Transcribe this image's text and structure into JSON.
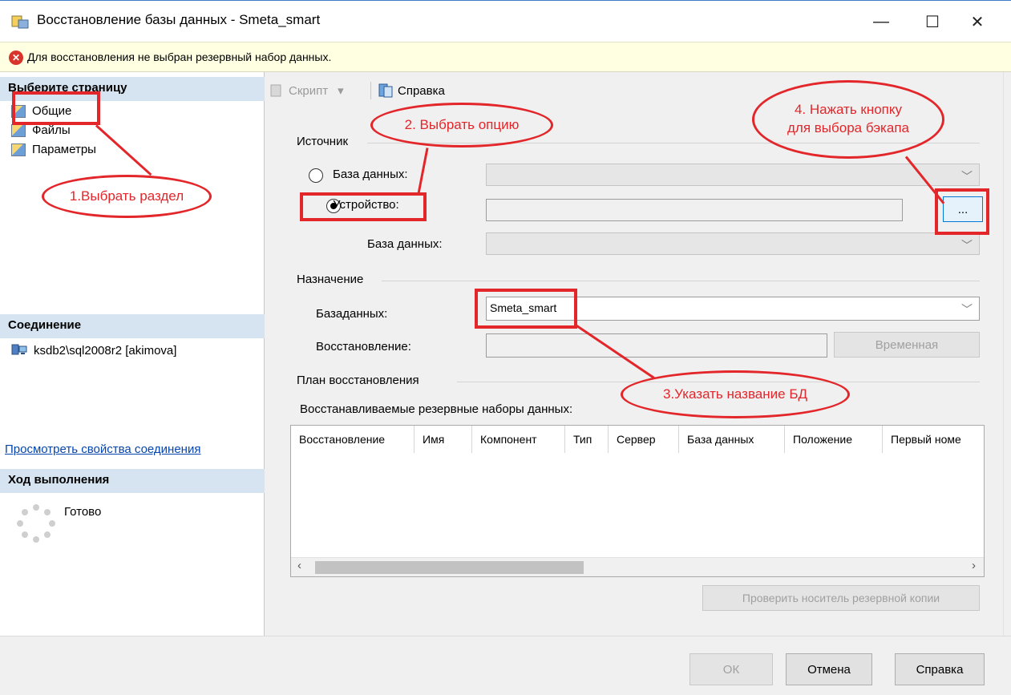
{
  "window": {
    "title": "Восстановление базы данных - Smeta_smart",
    "controls": {
      "minimize": "—",
      "maximize": "☐",
      "close": "✕"
    }
  },
  "error_bar": {
    "message": "Для восстановления не выбран резервный набор данных."
  },
  "left_panel": {
    "select_page_header": "Выберите страницу",
    "pages": [
      "Общие",
      "Файлы",
      "Параметры"
    ],
    "connection_header": "Соединение",
    "connection_value": "ksdb2\\sql2008r2 [akimova]",
    "connection_link": "Просмотреть свойства соединения",
    "progress_header": "Ход выполнения",
    "progress_status": "Готово"
  },
  "toolbar": {
    "script_label": "Скрипт",
    "script_arrow": "▾",
    "help_label": "Справка"
  },
  "source": {
    "group_title": "Источник",
    "database_option": "База данных:",
    "device_option": "Устройство:",
    "device_database_label": "База данных:",
    "browse_button": "...",
    "selected_option": "device"
  },
  "destination": {
    "group_title": "Назначение",
    "database_label": "Базаданных:",
    "database_value": "Smeta_smart",
    "restore_to_label": "Восстановление:",
    "timeline_button": "Временная"
  },
  "restore_plan": {
    "group_title": "План восстановления",
    "sets_label": "Восстанавливаемые резервные наборы данных:",
    "columns": [
      "Восстановление",
      "Имя",
      "Компонент",
      "Тип",
      "Сервер",
      "База данных",
      "Положение",
      "Первый номе"
    ],
    "verify_button": "Проверить носитель резервной копии"
  },
  "buttons": {
    "ok": "ОК",
    "cancel": "Отмена",
    "help": "Справка"
  },
  "annotations": {
    "step1": "1.Выбрать раздел",
    "step2": "2. Выбрать опцию",
    "step3": "3.Указать название БД",
    "step4_line1": "4. Нажать кнопку",
    "step4_line2": "для выбора бэкапа"
  },
  "colors": {
    "annotation": "#e3262a",
    "section_header": "#d6e4f1",
    "error_bar": "#ffffe1",
    "link": "#0645ad"
  }
}
